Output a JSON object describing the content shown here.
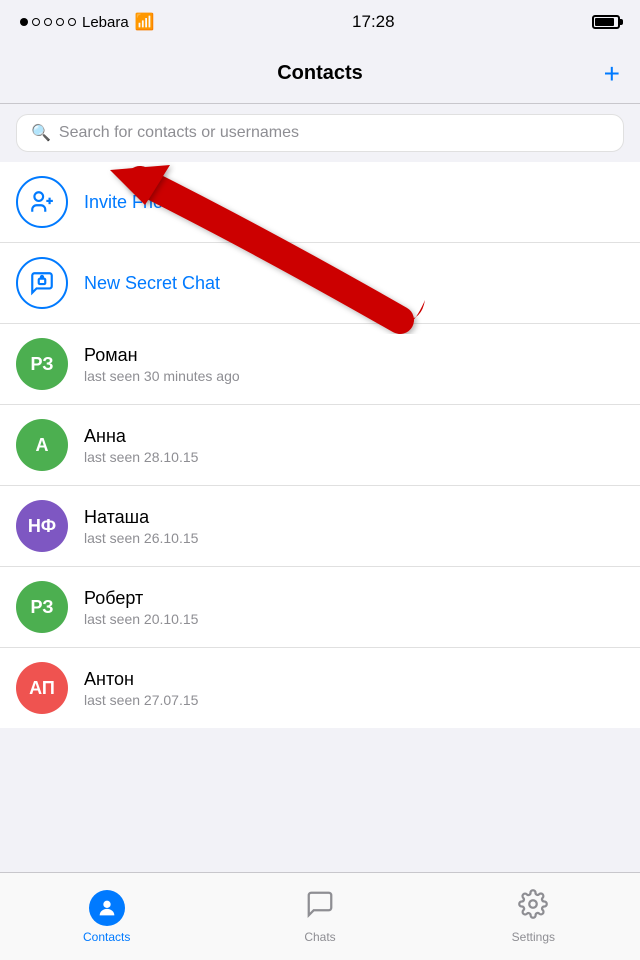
{
  "statusBar": {
    "carrier": "Lebara",
    "time": "17:28"
  },
  "navBar": {
    "title": "Contacts",
    "addBtn": "+"
  },
  "search": {
    "placeholder": "Search for contacts or usernames"
  },
  "actions": [
    {
      "id": "invite-friends",
      "label": "Invite Friends",
      "avatarType": "person-add",
      "avatarColor": "blue-outline"
    },
    {
      "id": "new-secret-chat",
      "label": "New Secret Chat",
      "avatarType": "lock",
      "avatarColor": "blue-outline"
    }
  ],
  "contacts": [
    {
      "initials": "РЗ",
      "name": "Роман",
      "status": "last seen 30 minutes ago",
      "color": "#4CAF50"
    },
    {
      "initials": "А",
      "name": "Анна",
      "status": "last seen 28.10.15",
      "color": "#4CAF50"
    },
    {
      "initials": "НФ",
      "name": "Наташа",
      "status": "last seen 26.10.15",
      "color": "#7E57C2"
    },
    {
      "initials": "РЗ",
      "name": "Роберт",
      "status": "last seen 20.10.15",
      "color": "#4CAF50"
    },
    {
      "initials": "АП",
      "name": "Антон",
      "status": "last seen 27.07.15",
      "color": "#EF5350"
    }
  ],
  "tabs": [
    {
      "id": "contacts",
      "label": "Contacts",
      "active": true
    },
    {
      "id": "chats",
      "label": "Chats",
      "active": false
    },
    {
      "id": "settings",
      "label": "Settings",
      "active": false
    }
  ]
}
